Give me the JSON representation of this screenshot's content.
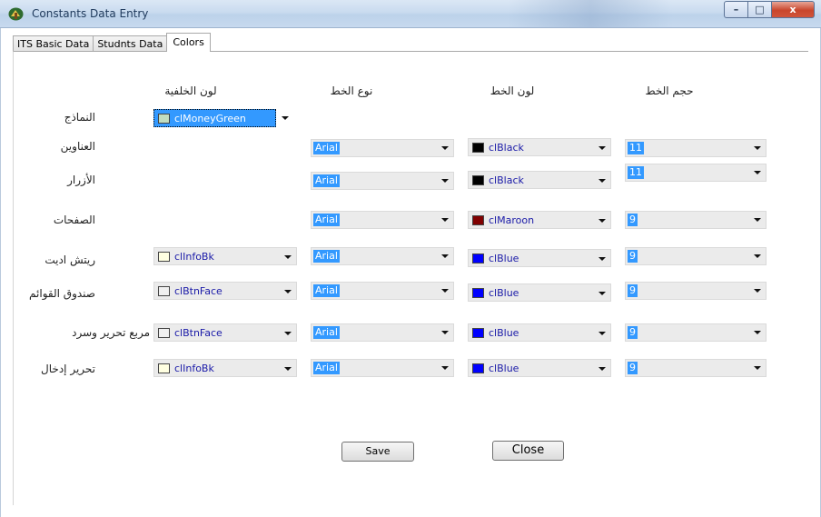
{
  "window": {
    "title": "Constants Data Entry",
    "min": "–",
    "max": "□",
    "close": "x"
  },
  "tabs": [
    "ITS Basic Data",
    "Studnts Data",
    "Colors"
  ],
  "columns": {
    "background_color": "لون الخلفية",
    "font_type": "نوع الخط",
    "font_color": "لون الخط",
    "font_size": "حجم الخط"
  },
  "rows": [
    {
      "label": "النماذج",
      "bg": {
        "text": "clMoneyGreen",
        "color": "#c0dcc0"
      }
    },
    {
      "label": "العناوين",
      "font": "Arial",
      "fcolor": {
        "text": "clBlack",
        "color": "#000000"
      },
      "size": "11"
    },
    {
      "label": "الأزرار",
      "font": "Arial",
      "fcolor": {
        "text": "clBlack",
        "color": "#000000"
      },
      "size": "11"
    },
    {
      "label": "الصفحات",
      "font": "Arial",
      "fcolor": {
        "text": "clMaroon",
        "color": "#800000"
      },
      "size": "9"
    },
    {
      "label": "ريتش اديت",
      "bg": {
        "text": "clInfoBk",
        "color": "#ffffe1"
      },
      "font": "Arial",
      "fcolor": {
        "text": "clBlue",
        "color": "#0000ff"
      },
      "size": "9"
    },
    {
      "label": "صندوق القوائم",
      "bg": {
        "text": "clBtnFace",
        "color": "#f0f0f0"
      },
      "font": "Arial",
      "fcolor": {
        "text": "clBlue",
        "color": "#0000ff"
      },
      "size": "9"
    },
    {
      "label": "مربع تحرير وسرد",
      "bg": {
        "text": "clBtnFace",
        "color": "#f0f0f0"
      },
      "font": "Arial",
      "fcolor": {
        "text": "clBlue",
        "color": "#0000ff"
      },
      "size": "9"
    },
    {
      "label": "تحرير إدخال",
      "bg": {
        "text": "clInfoBk",
        "color": "#ffffe1"
      },
      "font": "Arial",
      "fcolor": {
        "text": "clBlue",
        "color": "#0000ff"
      },
      "size": "9"
    }
  ],
  "buttons": {
    "save": "Save",
    "close": "Close"
  }
}
